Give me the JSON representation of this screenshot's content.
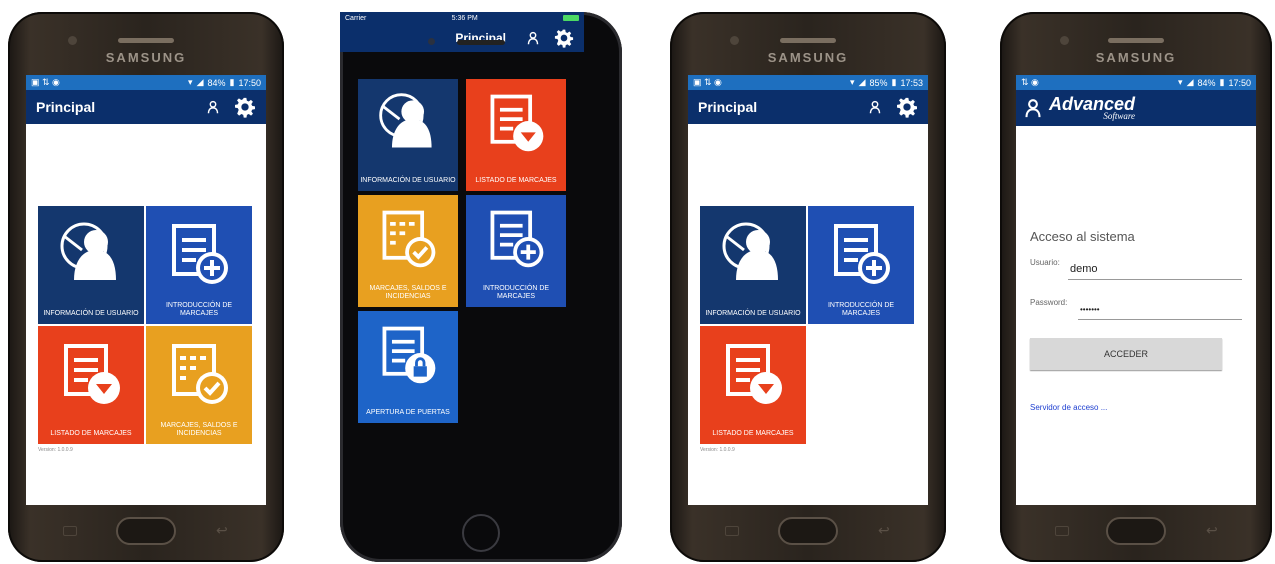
{
  "phone1": {
    "brand": "SAMSUNG",
    "status_time": "17:50",
    "status_battery": "84%",
    "title": "Principal",
    "tiles": [
      {
        "label": "INFORMACIÓN DE USUARIO"
      },
      {
        "label": "INTRODUCCIÓN DE MARCAJES"
      },
      {
        "label": "LISTADO DE MARCAJES"
      },
      {
        "label": "MARCAJES, SALDOS E INCIDENCIAS"
      }
    ],
    "version": "Version: 1.0.0.9"
  },
  "phone2": {
    "carrier": "Carrier",
    "status_time": "5:36 PM",
    "title": "Principal",
    "tiles": [
      {
        "label": "INFORMACIÓN DE USUARIO"
      },
      {
        "label": "LISTADO DE MARCAJES"
      },
      {
        "label": "MARCAJES, SALDOS E INCIDENCIAS"
      },
      {
        "label": "INTRODUCCIÓN DE MARCAJES"
      },
      {
        "label": "APERTURA DE PUERTAS"
      }
    ]
  },
  "phone3": {
    "brand": "SAMSUNG",
    "status_time": "17:53",
    "status_battery": "85%",
    "title": "Principal",
    "tiles": [
      {
        "label": "INFORMACIÓN DE USUARIO"
      },
      {
        "label": "INTRODUCCIÓN DE MARCAJES"
      },
      {
        "label": "LISTADO DE MARCAJES"
      }
    ],
    "version": "Version: 1.0.0.9"
  },
  "phone4": {
    "brand": "SAMSUNG",
    "status_time": "17:50",
    "status_battery": "84%",
    "logo_main": "Advanced",
    "logo_sub": "Software",
    "heading": "Acceso al sistema",
    "user_label": "Usuario:",
    "user_value": "demo",
    "password_label": "Password:",
    "password_value": "•••••••",
    "submit_label": "ACCEDER",
    "server_link": "Servidor de acceso ..."
  },
  "colors": {
    "appbar": "#0b2f6b",
    "statusbar": "#1e6fbf",
    "tile_navy": "#14376e",
    "tile_blue": "#1f4fb3",
    "tile_red": "#e8401c",
    "tile_orange": "#e8a020",
    "link": "#1e3fd0"
  }
}
